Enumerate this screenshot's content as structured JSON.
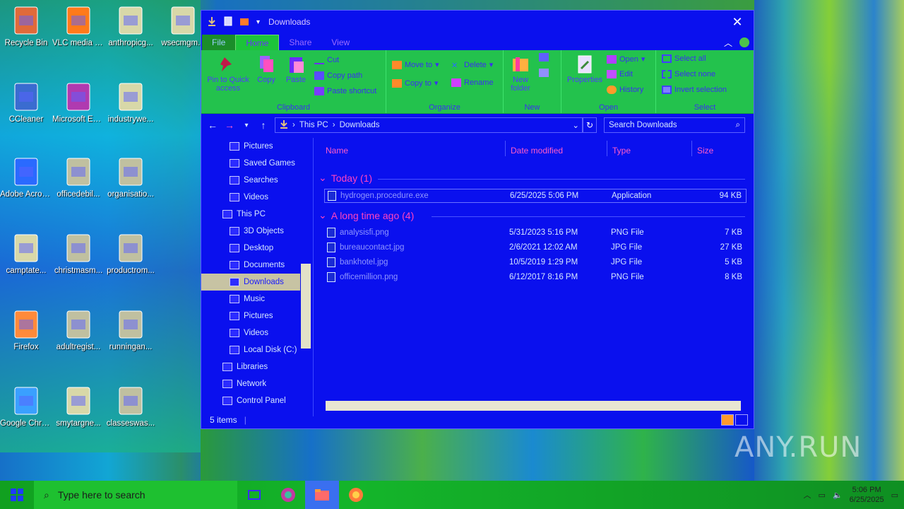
{
  "desktop": {
    "icons": [
      {
        "label": "Recycle Bin",
        "icon": "recycle-bin-icon"
      },
      {
        "label": "VLC media player",
        "icon": "vlc-icon"
      },
      {
        "label": "anthropicg...",
        "icon": "document-icon"
      },
      {
        "label": "wsecmgm...",
        "icon": "document-icon"
      },
      {
        "label": "CCleaner",
        "icon": "ccleaner-icon"
      },
      {
        "label": "Microsoft Edge",
        "icon": "edge-icon"
      },
      {
        "label": "industrywe...",
        "icon": "document-icon"
      },
      {
        "label": "Adobe Acrobat",
        "icon": "acrobat-icon"
      },
      {
        "label": "officedebil...",
        "icon": "image-file-icon"
      },
      {
        "label": "organisatio...",
        "icon": "image-file-icon"
      },
      {
        "label": "camptate...",
        "icon": "document-icon"
      },
      {
        "label": "christmasm...",
        "icon": "image-file-icon"
      },
      {
        "label": "productrom...",
        "icon": "image-file-icon"
      },
      {
        "label": "Firefox",
        "icon": "firefox-icon"
      },
      {
        "label": "adultregist...",
        "icon": "image-file-icon"
      },
      {
        "label": "runningan...",
        "icon": "image-file-icon"
      },
      {
        "label": "Google Chrome",
        "icon": "chrome-icon"
      },
      {
        "label": "smytargne...",
        "icon": "document-icon"
      },
      {
        "label": "classeswas...",
        "icon": "image-file-icon"
      }
    ]
  },
  "window": {
    "title": "Downloads",
    "close_glyph": "✕",
    "tabs": {
      "file": "File",
      "home": "Home",
      "share": "Share",
      "view": "View"
    },
    "ribbon": {
      "clipboard": {
        "group": "Clipboard",
        "pin": "Pin to Quick access",
        "copy": "Copy",
        "paste": "Paste",
        "cut": "Cut",
        "copy_path": "Copy path",
        "paste_shortcut": "Paste shortcut"
      },
      "organize": {
        "group": "Organize",
        "move_to": "Move to",
        "copy_to": "Copy to",
        "delete": "Delete",
        "rename": "Rename"
      },
      "new": {
        "group": "New",
        "new_folder": "New folder"
      },
      "open": {
        "group": "Open",
        "properties": "Properties",
        "open": "Open",
        "edit": "Edit",
        "history": "History"
      },
      "select": {
        "group": "Select",
        "select_all": "Select all",
        "select_none": "Select none",
        "invert": "Invert selection"
      }
    },
    "address": {
      "root": "This PC",
      "current": "Downloads"
    },
    "search_placeholder": "Search Downloads",
    "nav": [
      {
        "label": "Pictures",
        "indent": 1
      },
      {
        "label": "Saved Games",
        "indent": 1
      },
      {
        "label": "Searches",
        "indent": 1
      },
      {
        "label": "Videos",
        "indent": 1
      },
      {
        "label": "This PC",
        "indent": 0
      },
      {
        "label": "3D Objects",
        "indent": 1
      },
      {
        "label": "Desktop",
        "indent": 1
      },
      {
        "label": "Documents",
        "indent": 1
      },
      {
        "label": "Downloads",
        "indent": 1,
        "selected": true
      },
      {
        "label": "Music",
        "indent": 1
      },
      {
        "label": "Pictures",
        "indent": 1
      },
      {
        "label": "Videos",
        "indent": 1
      },
      {
        "label": "Local Disk (C:)",
        "indent": 1
      },
      {
        "label": "Libraries",
        "indent": 0
      },
      {
        "label": "Network",
        "indent": 0
      },
      {
        "label": "Control Panel",
        "indent": 0
      }
    ],
    "columns": {
      "name": "Name",
      "date": "Date modified",
      "type": "Type",
      "size": "Size"
    },
    "groups": [
      {
        "title": "Today (1)",
        "files": [
          {
            "name": "hydrogen.procedure.exe",
            "date": "6/25/2025 5:06 PM",
            "type": "Application",
            "size": "94 KB",
            "selected": true
          }
        ]
      },
      {
        "title": "A long time ago (4)",
        "files": [
          {
            "name": "analysisfi.png",
            "date": "5/31/2023 5:16 PM",
            "type": "PNG File",
            "size": "7 KB"
          },
          {
            "name": "bureaucontact.jpg",
            "date": "2/6/2021 12:02 AM",
            "type": "JPG File",
            "size": "27 KB"
          },
          {
            "name": "bankhotel.jpg",
            "date": "10/5/2019 1:29 PM",
            "type": "JPG File",
            "size": "5 KB"
          },
          {
            "name": "officemillion.png",
            "date": "6/12/2017 8:16 PM",
            "type": "PNG File",
            "size": "8 KB"
          }
        ]
      }
    ],
    "status": "5 items"
  },
  "taskbar": {
    "search_placeholder": "Type here to search",
    "clock_time": "5:06 PM",
    "clock_date": "6/25/2025"
  },
  "watermark": "ANY.RUN"
}
